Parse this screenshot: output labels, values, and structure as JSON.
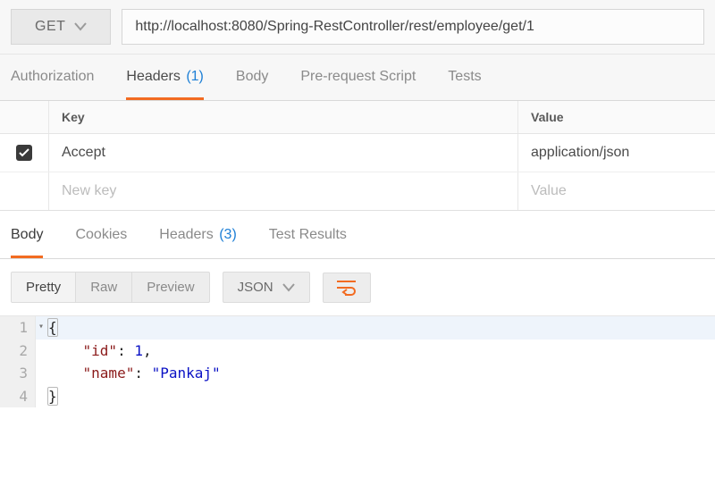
{
  "request": {
    "method": "GET",
    "url": "http://localhost:8080/Spring-RestController/rest/employee/get/1"
  },
  "request_tabs": {
    "authorization": "Authorization",
    "headers": "Headers",
    "headers_count": "(1)",
    "body": "Body",
    "prerequest": "Pre-request Script",
    "tests": "Tests"
  },
  "headers_table": {
    "col_key": "Key",
    "col_value": "Value",
    "rows": [
      {
        "key": "Accept",
        "value": "application/json"
      }
    ],
    "placeholder_key": "New key",
    "placeholder_value": "Value"
  },
  "response_tabs": {
    "body": "Body",
    "cookies": "Cookies",
    "headers": "Headers",
    "headers_count": "(3)",
    "test_results": "Test Results"
  },
  "view": {
    "pretty": "Pretty",
    "raw": "Raw",
    "preview": "Preview",
    "format": "JSON"
  },
  "response_body": {
    "lines": {
      "1": "{",
      "2": "    \"id\": 1,",
      "3": "    \"name\": \"Pankaj\"",
      "4": "}"
    },
    "json": {
      "id": 1,
      "name": "Pankaj"
    }
  },
  "line_numbers": {
    "1": "1",
    "2": "2",
    "3": "3",
    "4": "4"
  }
}
